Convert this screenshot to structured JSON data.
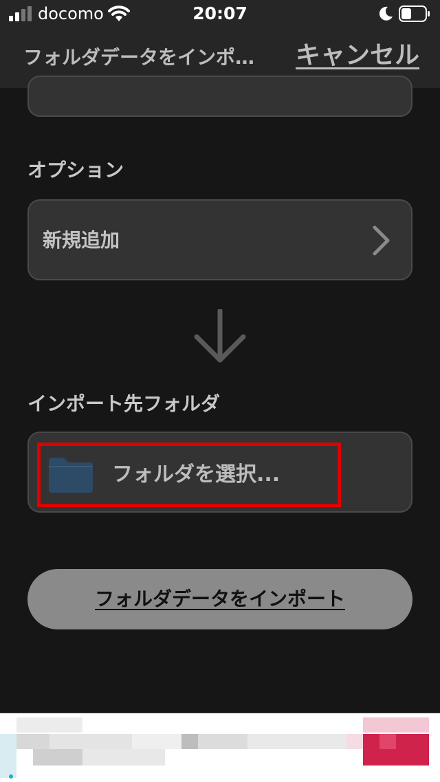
{
  "status_bar": {
    "carrier": "docomo",
    "time": "20:07",
    "icons": [
      "signal-icon",
      "wifi-icon",
      "moon-icon",
      "battery-icon"
    ]
  },
  "nav": {
    "title": "フォルダデータをインポ…",
    "cancel_label": "キャンセル"
  },
  "options": {
    "section_label": "オプション",
    "value": "新規追加",
    "icon": "chevron-right-icon"
  },
  "arrow_icon": "arrow-down-icon",
  "destination": {
    "section_label": "インポート先フォルダ",
    "select_label": "フォルダを選択...",
    "icon": "folder-icon"
  },
  "import_button": {
    "label": "フォルダデータをインポート"
  },
  "colors": {
    "background": "#161616",
    "card": "#333333",
    "highlight": "#e00000",
    "folder": "#2d4a66",
    "button": "#8a8a8a"
  }
}
